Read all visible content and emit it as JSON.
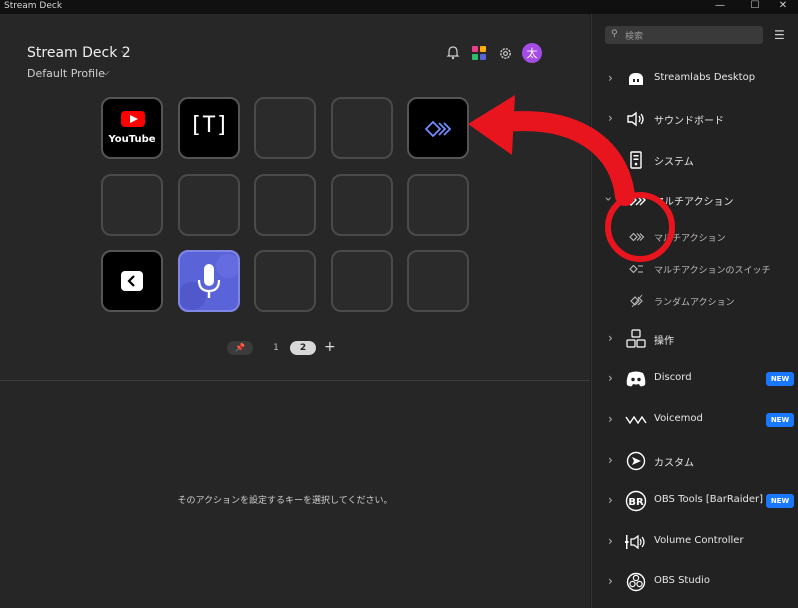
{
  "window": {
    "title": "Stream Deck",
    "minimize": "—",
    "maximize": "☐",
    "close": "✕"
  },
  "header": {
    "device": "Stream Deck 2",
    "profile": "Default Profile"
  },
  "keys": {
    "youtube_label": "YouTube",
    "text_icon": "[T]"
  },
  "pager": {
    "pin": "📌",
    "pages": [
      "1",
      "2"
    ],
    "active": "2",
    "add": "+"
  },
  "hint": "そのアクションを設定するキーを選択してください。",
  "search": {
    "placeholder": "検索"
  },
  "categories": [
    {
      "label": "Streamlabs Desktop",
      "icon": "streamlabs-icon"
    },
    {
      "label": "サウンドボード",
      "icon": "speaker-icon"
    },
    {
      "label": "システム",
      "icon": "system-icon"
    },
    {
      "label": "マルチアクション",
      "icon": "multi-action-icon",
      "expanded": true
    },
    {
      "label": "操作",
      "icon": "operation-icon"
    },
    {
      "label": "Discord",
      "icon": "discord-icon",
      "badge": "NEW"
    },
    {
      "label": "Voicemod",
      "icon": "voicemod-icon",
      "badge": "NEW"
    },
    {
      "label": "カスタム",
      "icon": "custom-icon"
    },
    {
      "label": "OBS Tools [BarRaider]",
      "icon": "barraider-icon",
      "badge": "NEW"
    },
    {
      "label": "Volume Controller",
      "icon": "volume-icon"
    },
    {
      "label": "OBS Studio",
      "icon": "obs-icon"
    }
  ],
  "multi_action_items": [
    {
      "label": "マルチアクション"
    },
    {
      "label": "マルチアクションのスイッチ"
    },
    {
      "label": "ランダムアクション"
    }
  ],
  "colors": {
    "accent": "#1a78ff",
    "annotation": "#e8141e",
    "key_purple": "#5b63d8"
  }
}
